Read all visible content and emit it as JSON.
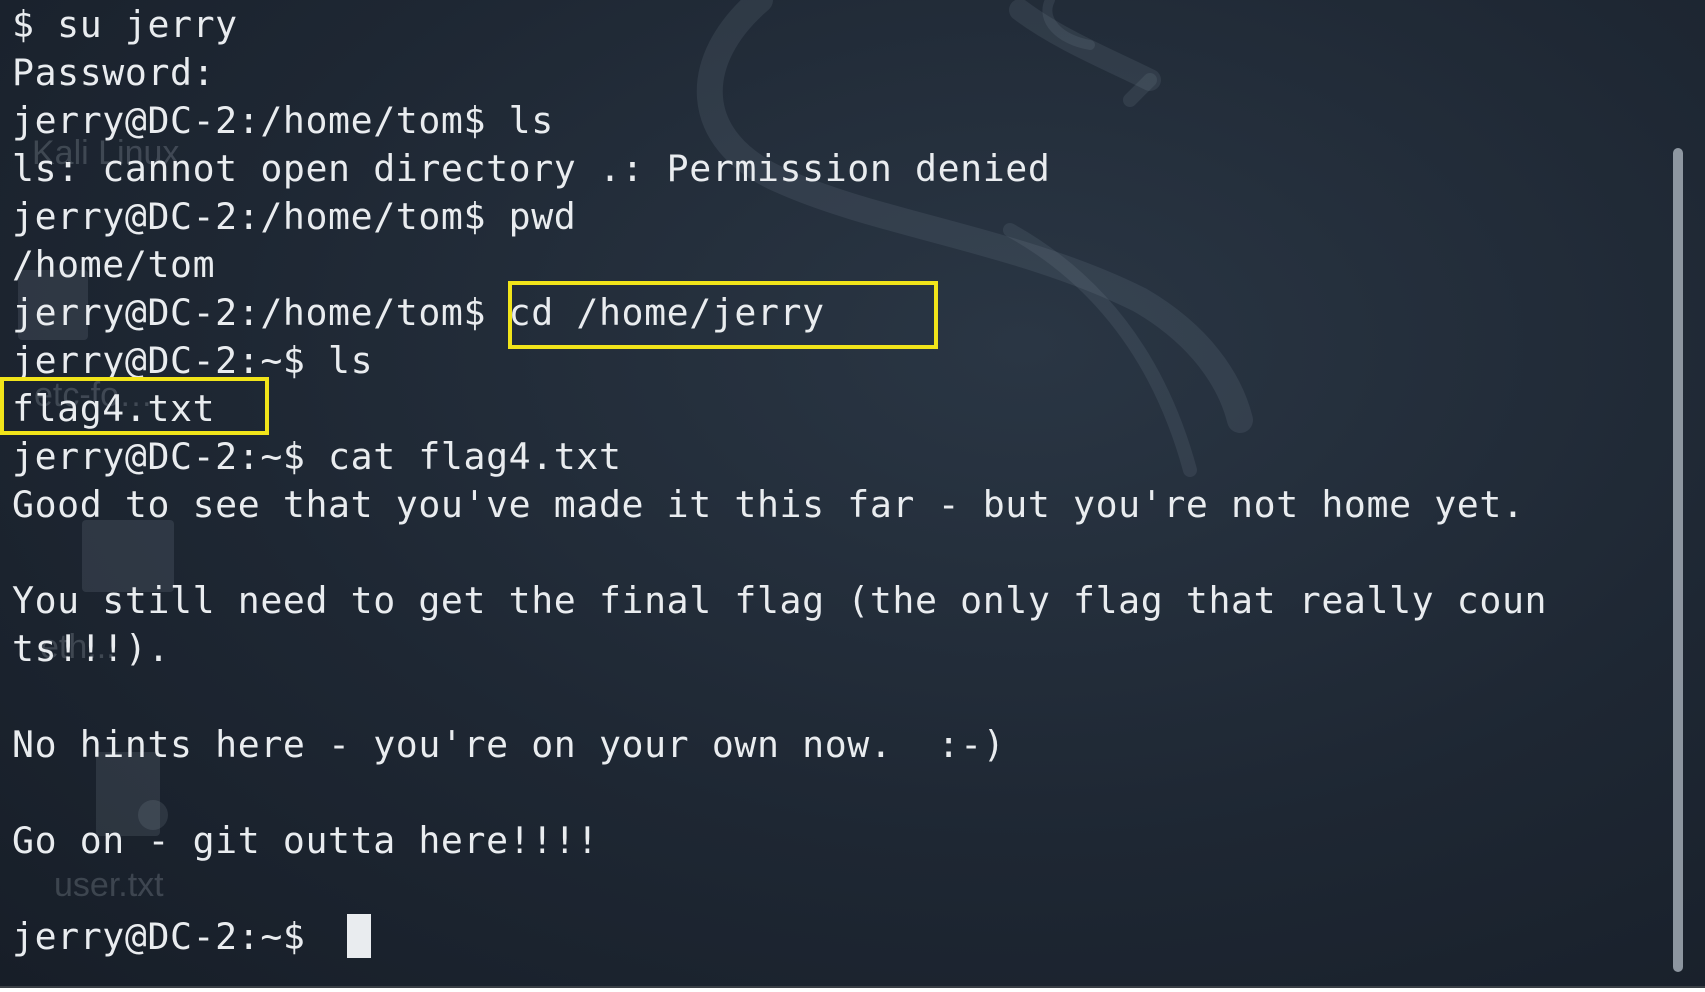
{
  "desktop": {
    "icon_labels": [
      "Kali Linux",
      "user.txt",
      "etc-fo…",
      "eth..."
    ]
  },
  "terminal": {
    "lines": [
      "$ su jerry",
      "Password:",
      "jerry@DC-2:/home/tom$ ls",
      "ls: cannot open directory .: Permission denied",
      "jerry@DC-2:/home/tom$ pwd",
      "/home/tom",
      "jerry@DC-2:/home/tom$ cd /home/jerry",
      "jerry@DC-2:~$ ls",
      "flag4.txt",
      "jerry@DC-2:~$ cat flag4.txt",
      "Good to see that you've made it this far - but you're not home yet.",
      "",
      "You still need to get the final flag (the only flag that really coun",
      "ts!!!).",
      "",
      "No hints here - you're on your own now.  :-)",
      "",
      "Go on - git outta here!!!!",
      "",
      "jerry@DC-2:~$ "
    ]
  },
  "colors": {
    "background": "#1e2733",
    "text": "#e9ecef",
    "highlight": "#f1e41a"
  }
}
